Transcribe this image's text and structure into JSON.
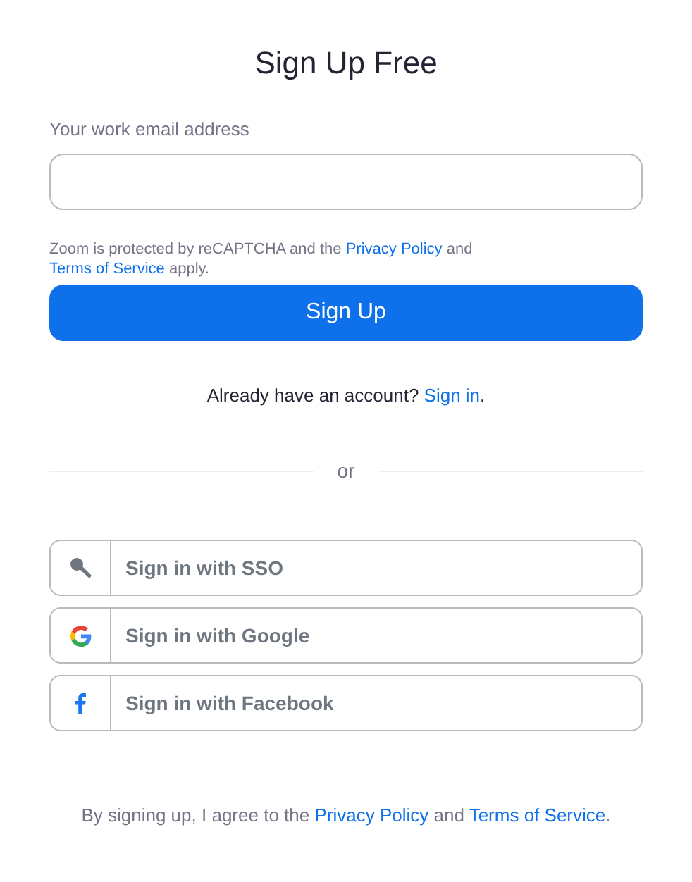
{
  "title": "Sign Up Free",
  "email_field": {
    "label": "Your work email address"
  },
  "recaptcha_notice": [
    {
      "kind": "text",
      "text": "Zoom is protected by reCAPTCHA and the "
    },
    {
      "kind": "link",
      "text": "Privacy Policy"
    },
    {
      "kind": "text",
      "text": " and "
    },
    {
      "kind": "link",
      "text": "Terms of Service"
    },
    {
      "kind": "text",
      "text": " apply."
    }
  ],
  "sign_up_button": "Sign Up",
  "account_prompt": [
    {
      "kind": "text",
      "text": "Already have an account? "
    },
    {
      "kind": "link",
      "text": "Sign in"
    },
    {
      "kind": "text",
      "text": "."
    }
  ],
  "divider": "or",
  "providers": [
    {
      "kind": "sso",
      "label": "Sign in with SSO"
    },
    {
      "kind": "google",
      "label": "Sign in with Google"
    },
    {
      "kind": "facebook",
      "label": "Sign in with Facebook"
    }
  ],
  "footer": [
    {
      "kind": "text",
      "text": "By signing up, I agree to the "
    },
    {
      "kind": "link",
      "text": "Privacy Policy"
    },
    {
      "kind": "text",
      "text": " and "
    },
    {
      "kind": "link",
      "text": "Terms of Service"
    },
    {
      "kind": "text",
      "text": "."
    }
  ]
}
